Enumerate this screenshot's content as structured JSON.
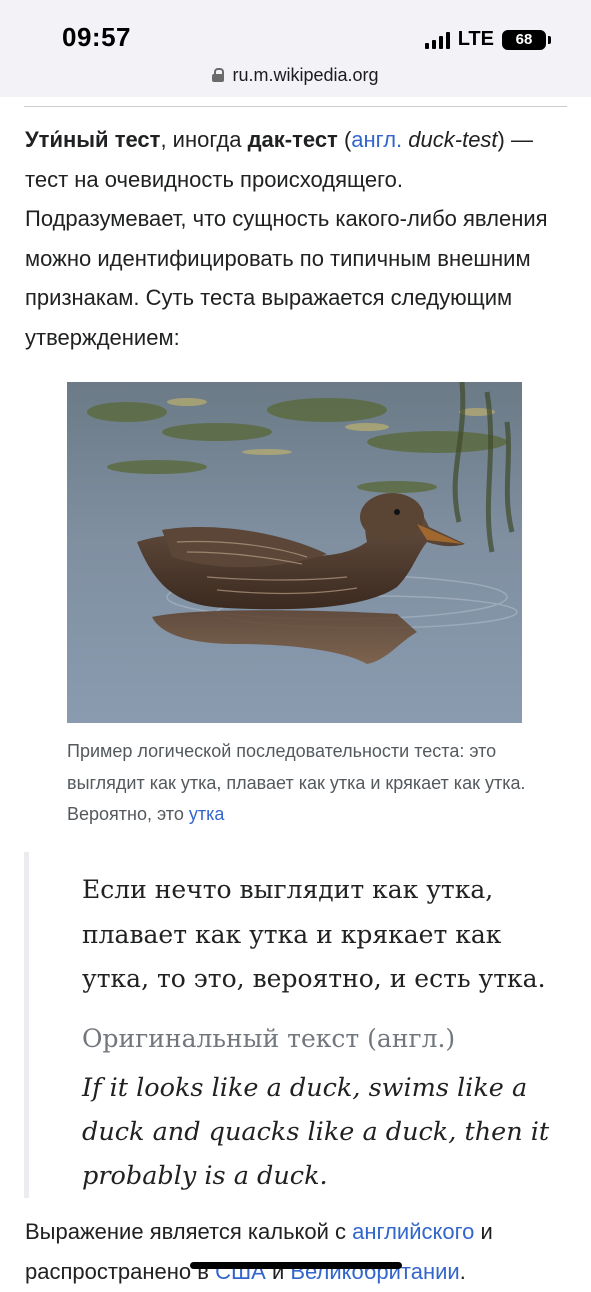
{
  "status_bar": {
    "time": "09:57",
    "network": "LTE",
    "battery": "68"
  },
  "url_bar": {
    "domain": "ru.m.wikipedia.org"
  },
  "article": {
    "lead": {
      "term": "Ути́ный тест",
      "text1": ", иногда ",
      "alt_term": "дак-тест",
      "text2": " (",
      "lang_link": "англ.",
      "english_term": " duck-test",
      "text3": ") — тест на очевидность происходящего. Подразумевает, что сущность какого-либо явления можно идентифицировать по типичным внешним признакам. Суть теста выражается следующим утверждением:"
    },
    "figure": {
      "image_name": "duck-photo",
      "caption_text": "Пример логической последовательности теста: это выглядит как утка, плавает как утка и крякает как утка. Вероятно, это ",
      "caption_link": "утка"
    },
    "quote": {
      "russian": "Если нечто выглядит как утка, плавает как утка и крякает как утка, то это, вероятно, и есть утка.",
      "original_label": "Оригинальный текст (англ.)",
      "english": "If it looks like a duck, swims like a duck and quacks like a duck, then it probably is a duck."
    },
    "after": {
      "text1": "Выражение является калькой с ",
      "link1": "английского",
      "text2": " и распространено в ",
      "link2": "США",
      "text3": " и ",
      "link3": "Великобритании",
      "text4": "."
    }
  },
  "colors": {
    "link": "#3366cc",
    "text": "#202122",
    "caption": "#54595d",
    "quote_border": "#eaecf0"
  }
}
